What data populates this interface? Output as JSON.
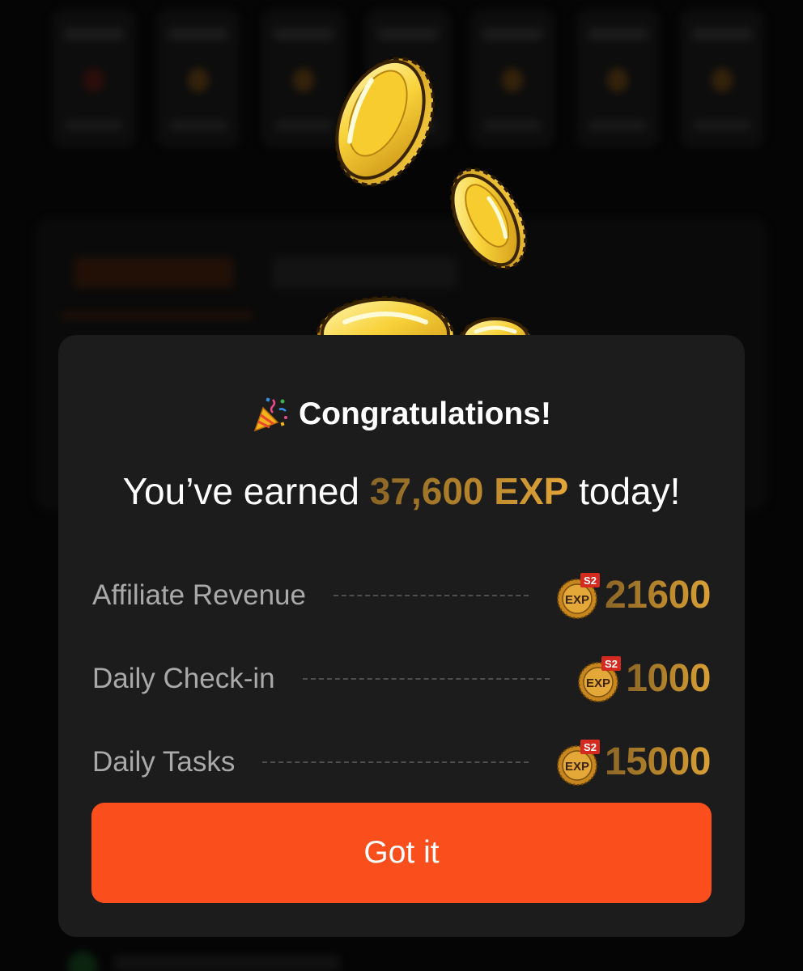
{
  "modal": {
    "title": "Congratulations!",
    "earned_prefix": "You’ve earned ",
    "earned_amount": "37,600 EXP",
    "earned_suffix": " today!",
    "rows": [
      {
        "label": "Affiliate Revenue",
        "badge_top": "S2",
        "badge_main": "EXP",
        "value": "21600"
      },
      {
        "label": "Daily Check-in",
        "badge_top": "S2",
        "badge_main": "EXP",
        "value": "1000"
      },
      {
        "label": "Daily Tasks",
        "badge_top": "S2",
        "badge_main": "EXP",
        "value": "15000"
      }
    ],
    "button_label": "Got it"
  },
  "icons": {
    "title_icon": "party-popper-icon",
    "badge_icon": "exp-coin-icon",
    "falling": "gold-coin-icon"
  },
  "colors": {
    "accent_button": "#fa4e1d",
    "gold": "#c08a2c",
    "modal_bg": "#1c1c1c",
    "page_bg": "#050505",
    "badge_red": "#d52a1f"
  }
}
